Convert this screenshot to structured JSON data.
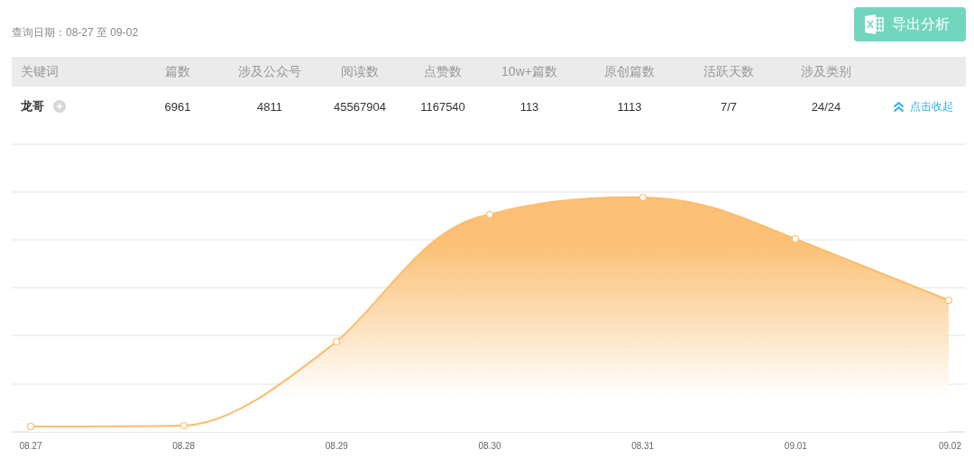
{
  "query_date": "查询日期：08-27 至 09-02",
  "export_button": {
    "label": "导出分析"
  },
  "table": {
    "columns": [
      "关键词",
      "篇数",
      "涉及公众号",
      "阅读数",
      "点赞数",
      "10w+篇数",
      "原创篇数",
      "活跃天数",
      "涉及类别"
    ],
    "rows": [
      {
        "cells": [
          "龙哥",
          "6961",
          "4811",
          "45567904",
          "1167540",
          "113",
          "1113",
          "7/7",
          "24/24"
        ],
        "action": "点击收起"
      }
    ]
  },
  "chart": {
    "x_labels": [
      "08.27",
      "08.28",
      "08.29",
      "08.30",
      "08.31",
      "09.01",
      "09.02"
    ]
  }
}
